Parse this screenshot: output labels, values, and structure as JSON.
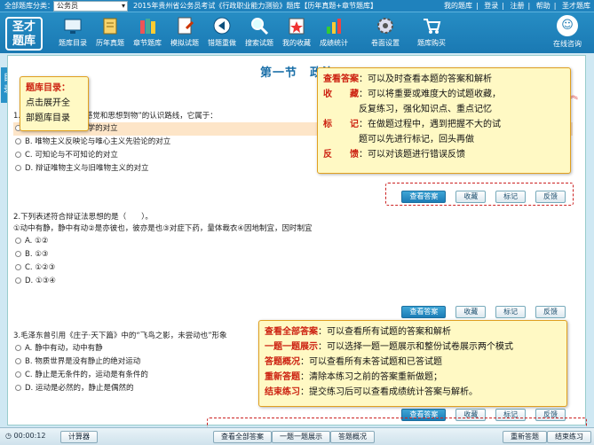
{
  "topbar": {
    "category_label": "全部题库分类：",
    "category_value": "公务员",
    "exam_title": "2015年贵州省公务员考试《行政职业能力测验》题库【历年真题+章节题库】",
    "links": [
      "我的题库",
      "登录",
      "注册",
      "帮助",
      "圣才题库"
    ]
  },
  "logo": {
    "line1": "圣才",
    "line2": "题库"
  },
  "nav": [
    "题库目录",
    "历年真题",
    "章节题库",
    "模拟试题",
    "错题重做",
    "搜索试题",
    "我的收藏",
    "成绩统计",
    "卷面设置",
    "题库购买"
  ],
  "online": "在线咨询",
  "side_tab": "目录",
  "section_title": "第一节　政治",
  "questions": [
    {
      "text": "1.“从思想到物”与“从感觉和思想到物”的认识路线，它属于：",
      "options": [
        {
          "label": "A.",
          "text": "辩证法与形而上学的对立"
        },
        {
          "label": "B.",
          "text": "唯物主义反映论与唯心主义先验论的对立"
        },
        {
          "label": "C.",
          "text": "可知论与不可知论的对立"
        },
        {
          "label": "D.",
          "text": "辩证唯物主义与旧唯物主义的对立"
        }
      ]
    },
    {
      "text": "2.下列表述符合辩证法思想的是（　　）。",
      "subtext": "①动中有静，静中有动②是亦彼也，彼亦是也③对症下药，量体裁衣④因地制宜，因时制宜",
      "options": [
        {
          "label": "A.",
          "text": "①②"
        },
        {
          "label": "B.",
          "text": "①③"
        },
        {
          "label": "C.",
          "text": "①②③"
        },
        {
          "label": "D.",
          "text": "①③④"
        }
      ]
    },
    {
      "text": "3.毛泽东曾引用《庄子·天下篇》中的“飞鸟之影，未尝动也”形象",
      "options": [
        {
          "label": "A.",
          "text": "静中有动，动中有静"
        },
        {
          "label": "B.",
          "text": "物质世界是没有静止的绝对运动"
        },
        {
          "label": "C.",
          "text": "静止是无条件的，运动是有条件的"
        },
        {
          "label": "D.",
          "text": "运动是必然的，静止是偶然的"
        }
      ]
    }
  ],
  "buttons": {
    "answer": "查看答案",
    "collect": "收藏",
    "mark": "标记",
    "feedback": "反馈"
  },
  "tip_catalog": [
    "题库目录：",
    "点击展开全",
    "部题库目录"
  ],
  "tip_answer": [
    {
      "k": "查看答案",
      "v": "：可以及时查看本题的答案和解析"
    },
    {
      "k": "收　　藏",
      "v": "：可以将重要或难度大的试题收藏，"
    },
    {
      "k": "",
      "v": "　　　　反复练习，强化知识点、重点记忆"
    },
    {
      "k": "标　　记",
      "v": "：在做题过程中，遇到把握不大的试"
    },
    {
      "k": "",
      "v": "　　　　题可以先进行标记，回头再做"
    },
    {
      "k": "反　　馈",
      "v": "：可以对该题进行错误反馈"
    }
  ],
  "tip_bottom": [
    {
      "k": "查看全部答案",
      "v": "：可以查看所有试题的答案和解析"
    },
    {
      "k": "一题一题展示",
      "v": "：可以选择一题一题展示和整份试卷展示两个模式"
    },
    {
      "k": "答题概况",
      "v": "：可以查看所有未答试题和已答试题"
    },
    {
      "k": "重新答题",
      "v": "：清除本练习之前的答案重新做题；"
    },
    {
      "k": "结束练习",
      "v": "：提交练习后可以查看成绩统计答案与解析。"
    }
  ],
  "bottom": {
    "clock": "00:00:12",
    "calculator": "计算器",
    "view_all": "查看全部答案",
    "one_by_one": "一题一题展示",
    "overview": "答题概况",
    "restart": "重新答题",
    "finish": "结束练习"
  }
}
